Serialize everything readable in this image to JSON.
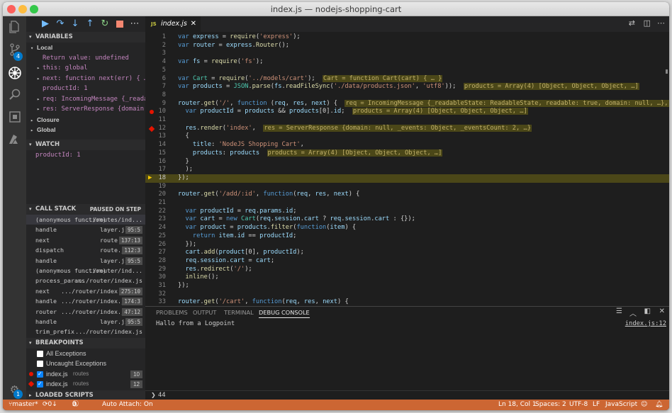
{
  "window": {
    "title": "index.js — nodejs-shopping-cart"
  },
  "activity": {
    "scm_badge": "4",
    "settings_badge": "1"
  },
  "sidebar": {
    "variables": {
      "header": "VARIABLES",
      "local_label": "Local",
      "return_value": "Return value: undefined",
      "this_value": "this: global",
      "next_value": "next: function next(err) { … }",
      "product_id": "productId: 1",
      "req_value": "req: IncomingMessage {_readableSt…",
      "res_value": "res: ServerResponse {domain: null…",
      "closure_label": "Closure",
      "global_label": "Global"
    },
    "watch": {
      "header": "WATCH",
      "item": "productId: 1"
    },
    "call_stack": {
      "header": "CALL STACK",
      "status": "PAUSED ON STEP",
      "frames": [
        {
          "fn": "(anonymous function)",
          "file": ".../routes/ind...",
          "pos": ""
        },
        {
          "fn": "handle",
          "file": "layer.js",
          "pos": "95:5"
        },
        {
          "fn": "next",
          "file": "route.js",
          "pos": "137:13"
        },
        {
          "fn": "dispatch",
          "file": "route.js",
          "pos": "112:3"
        },
        {
          "fn": "handle",
          "file": "layer.js",
          "pos": "95:5"
        },
        {
          "fn": "(anonymous function)",
          "file": ".../router/ind...",
          "pos": ""
        },
        {
          "fn": "process_params",
          "file": ".../router/index.js",
          "pos": ""
        },
        {
          "fn": "next",
          "file": ".../router/index.js",
          "pos": "275:10"
        },
        {
          "fn": "handle",
          "file": ".../router/index.js",
          "pos": "174:3"
        },
        {
          "fn": "router",
          "file": ".../router/index.js",
          "pos": "47:12"
        },
        {
          "fn": "handle",
          "file": "layer.js",
          "pos": "95:5"
        },
        {
          "fn": "trim_prefix",
          "file": ".../router/index.js",
          "pos": ""
        }
      ]
    },
    "breakpoints": {
      "header": "BREAKPOINTS",
      "all_exceptions": "All Exceptions",
      "uncaught_exceptions": "Uncaught Exceptions",
      "items": [
        {
          "file": "index.js",
          "folder": "routes",
          "line": "10"
        },
        {
          "file": "index.js",
          "folder": "routes",
          "line": "12"
        }
      ]
    },
    "loaded_scripts": "LOADED SCRIPTS"
  },
  "editor": {
    "tab_label": "index.js",
    "tab_icon": "JS",
    "lines": [
      "var express = require('express');",
      "var router = express.Router();",
      "",
      "var fs = require('fs');",
      "",
      "var Cart = require('../models/cart');",
      "var products = JSON.parse(fs.readFileSync('./data/products.json', 'utf8'));",
      "",
      "router.get('/', function (req, res, next) {",
      "  var productId = products && products[0].id;",
      "",
      "  res.render('index',",
      "  {",
      "    title: 'NodeJS Shopping Cart',",
      "    products: products",
      "  }",
      "  );",
      "});",
      "",
      "router.get('/add/:id', function(req, res, next) {",
      "",
      "  var productId = req.params.id;",
      "  var cart = new Cart(req.session.cart ? req.session.cart : {});",
      "  var product = products.filter(function(item) {",
      "    return item.id == productId;",
      "  });",
      "  cart.add(product[0], productId);",
      "  req.session.cart = cart;",
      "  res.redirect('/');",
      "  inline();",
      "});",
      "",
      "router.get('/cart', function(req, res, next) {"
    ],
    "inline_values": {
      "l6": "Cart = function Cart(cart) { … }",
      "l7": "products = Array(4) [Object, Object, Object, …]",
      "l9": "req = IncomingMessage {_readableState: ReadableState, readable: true, domain: null, …}, res = ServerRes",
      "l10": "products = Array(4) [Object, Object, Object, …]",
      "l12": "res = ServerResponse {domain: null, _events: Object, _eventsCount: 2, …}",
      "l15": "products = Array(4) [Object, Object, Object, …]"
    }
  },
  "panel": {
    "tabs": [
      "PROBLEMS",
      "OUTPUT",
      "TERMINAL",
      "DEBUG CONSOLE"
    ],
    "output": "Hallo from a Logpoint",
    "source_link": "index.js:12",
    "input_value": "44"
  },
  "status": {
    "branch": "master*",
    "sync": "0↓ 2↑",
    "errors": "0",
    "warnings": "0",
    "auto_attach": "Auto Attach: On",
    "position": "Ln 18, Col 1",
    "spaces": "Spaces: 2",
    "encoding": "UTF-8",
    "eol": "LF",
    "language": "JavaScript"
  },
  "colors": {
    "status_bar": "#cc6633",
    "accent": "#007acc",
    "highlight": "#4b4718"
  }
}
